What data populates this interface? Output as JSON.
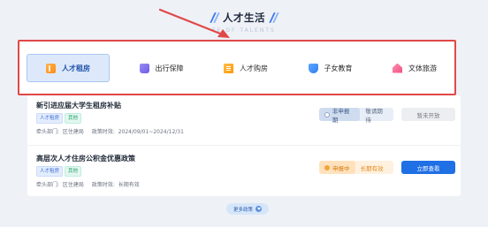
{
  "header": {
    "title": "人才生活",
    "subtitle": "FE OF TALENTS"
  },
  "colors": {
    "annotation": "#e04848",
    "primary": "#1f6fe5",
    "active_category_bg": "#dde9fb"
  },
  "categories": [
    {
      "label": "人才租房",
      "icon": "rent-icon",
      "active": true
    },
    {
      "label": "出行保障",
      "icon": "travel-icon",
      "active": false
    },
    {
      "label": "人才购房",
      "icon": "house-purchase-icon",
      "active": false
    },
    {
      "label": "子女教育",
      "icon": "education-icon",
      "active": false
    },
    {
      "label": "文体旅游",
      "icon": "culture-tourism-icon",
      "active": false
    }
  ],
  "policies": [
    {
      "title": "新引进应届大学生租房补贴",
      "tags": [
        "人才租房",
        "其他"
      ],
      "dept_label": "牵头部门:",
      "dept_value": "区住建局",
      "period_label": "政策时效:",
      "period_value": "2024/09/01~2024/12/31",
      "status": "非申报期",
      "status_note": "敬请期待",
      "action": "暂未开放"
    },
    {
      "title": "高层次人才住房公积金优惠政策",
      "tags": [
        "人才租房",
        "其他"
      ],
      "dept_label": "牵头部门:",
      "dept_value": "区住建局",
      "period_label": "政策时效:",
      "period_value": "长期有效",
      "status": "申报中",
      "status_note": "长期有效",
      "action": "立即查看"
    }
  ],
  "more_button": "更多政策"
}
